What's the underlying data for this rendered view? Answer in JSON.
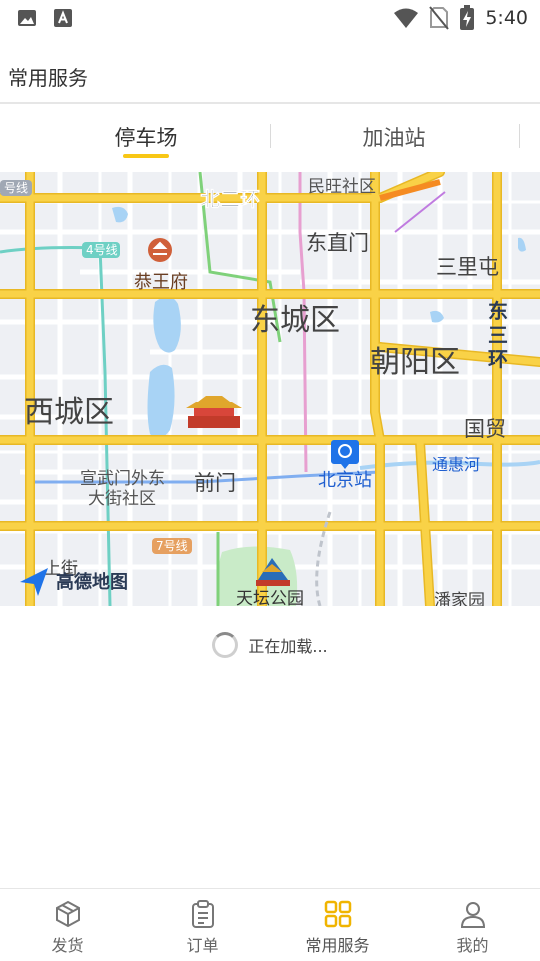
{
  "status_bar": {
    "time": "5:40",
    "left_icons": [
      "image-icon",
      "text-a-icon"
    ],
    "right_icons": [
      "wifi-icon",
      "no-sim-icon",
      "battery-charging-icon"
    ]
  },
  "header": {
    "title": "常用服务"
  },
  "tabs": [
    {
      "label": "停车场",
      "active": true
    },
    {
      "label": "加油站",
      "active": false
    }
  ],
  "map": {
    "labels": {
      "line4": "4号线",
      "line_left": "号线",
      "beierhuan": "北二环",
      "minwangshequ": "民旺社区",
      "dongzhimen": "东直门",
      "sanlitun": "三里屯",
      "gongwangfu": "恭王府",
      "dongchengqu": "东城区",
      "dongsanhuan": "东三环",
      "chaoyangqu": "朝阳区",
      "xichengqu": "西城区",
      "guomao": "国贸",
      "beijingzhan": "北京站",
      "tonghuihe": "通惠河",
      "xuanwumen1": "宣武门外东",
      "xuanwumen2": "大街社区",
      "qianmen": "前门",
      "line7": "7号线",
      "tiantan": "天坛公园",
      "panjiayuan": "潘家园",
      "shangjie": "上街",
      "amap_logo": "高德地图"
    },
    "colors": {
      "major_road": "#f9d247",
      "road_outline": "#e8b825",
      "water": "#a8d3f5",
      "park": "#c9ebc8",
      "background": "#eef0f4"
    }
  },
  "loading": {
    "text": "正在加载..."
  },
  "bottom_nav": [
    {
      "label": "发货",
      "icon": "box-icon",
      "active": false
    },
    {
      "label": "订单",
      "icon": "clipboard-icon",
      "active": false
    },
    {
      "label": "常用服务",
      "icon": "grid-icon",
      "active": true
    },
    {
      "label": "我的",
      "icon": "user-icon",
      "active": false
    }
  ],
  "accent_color": "#f8c715"
}
